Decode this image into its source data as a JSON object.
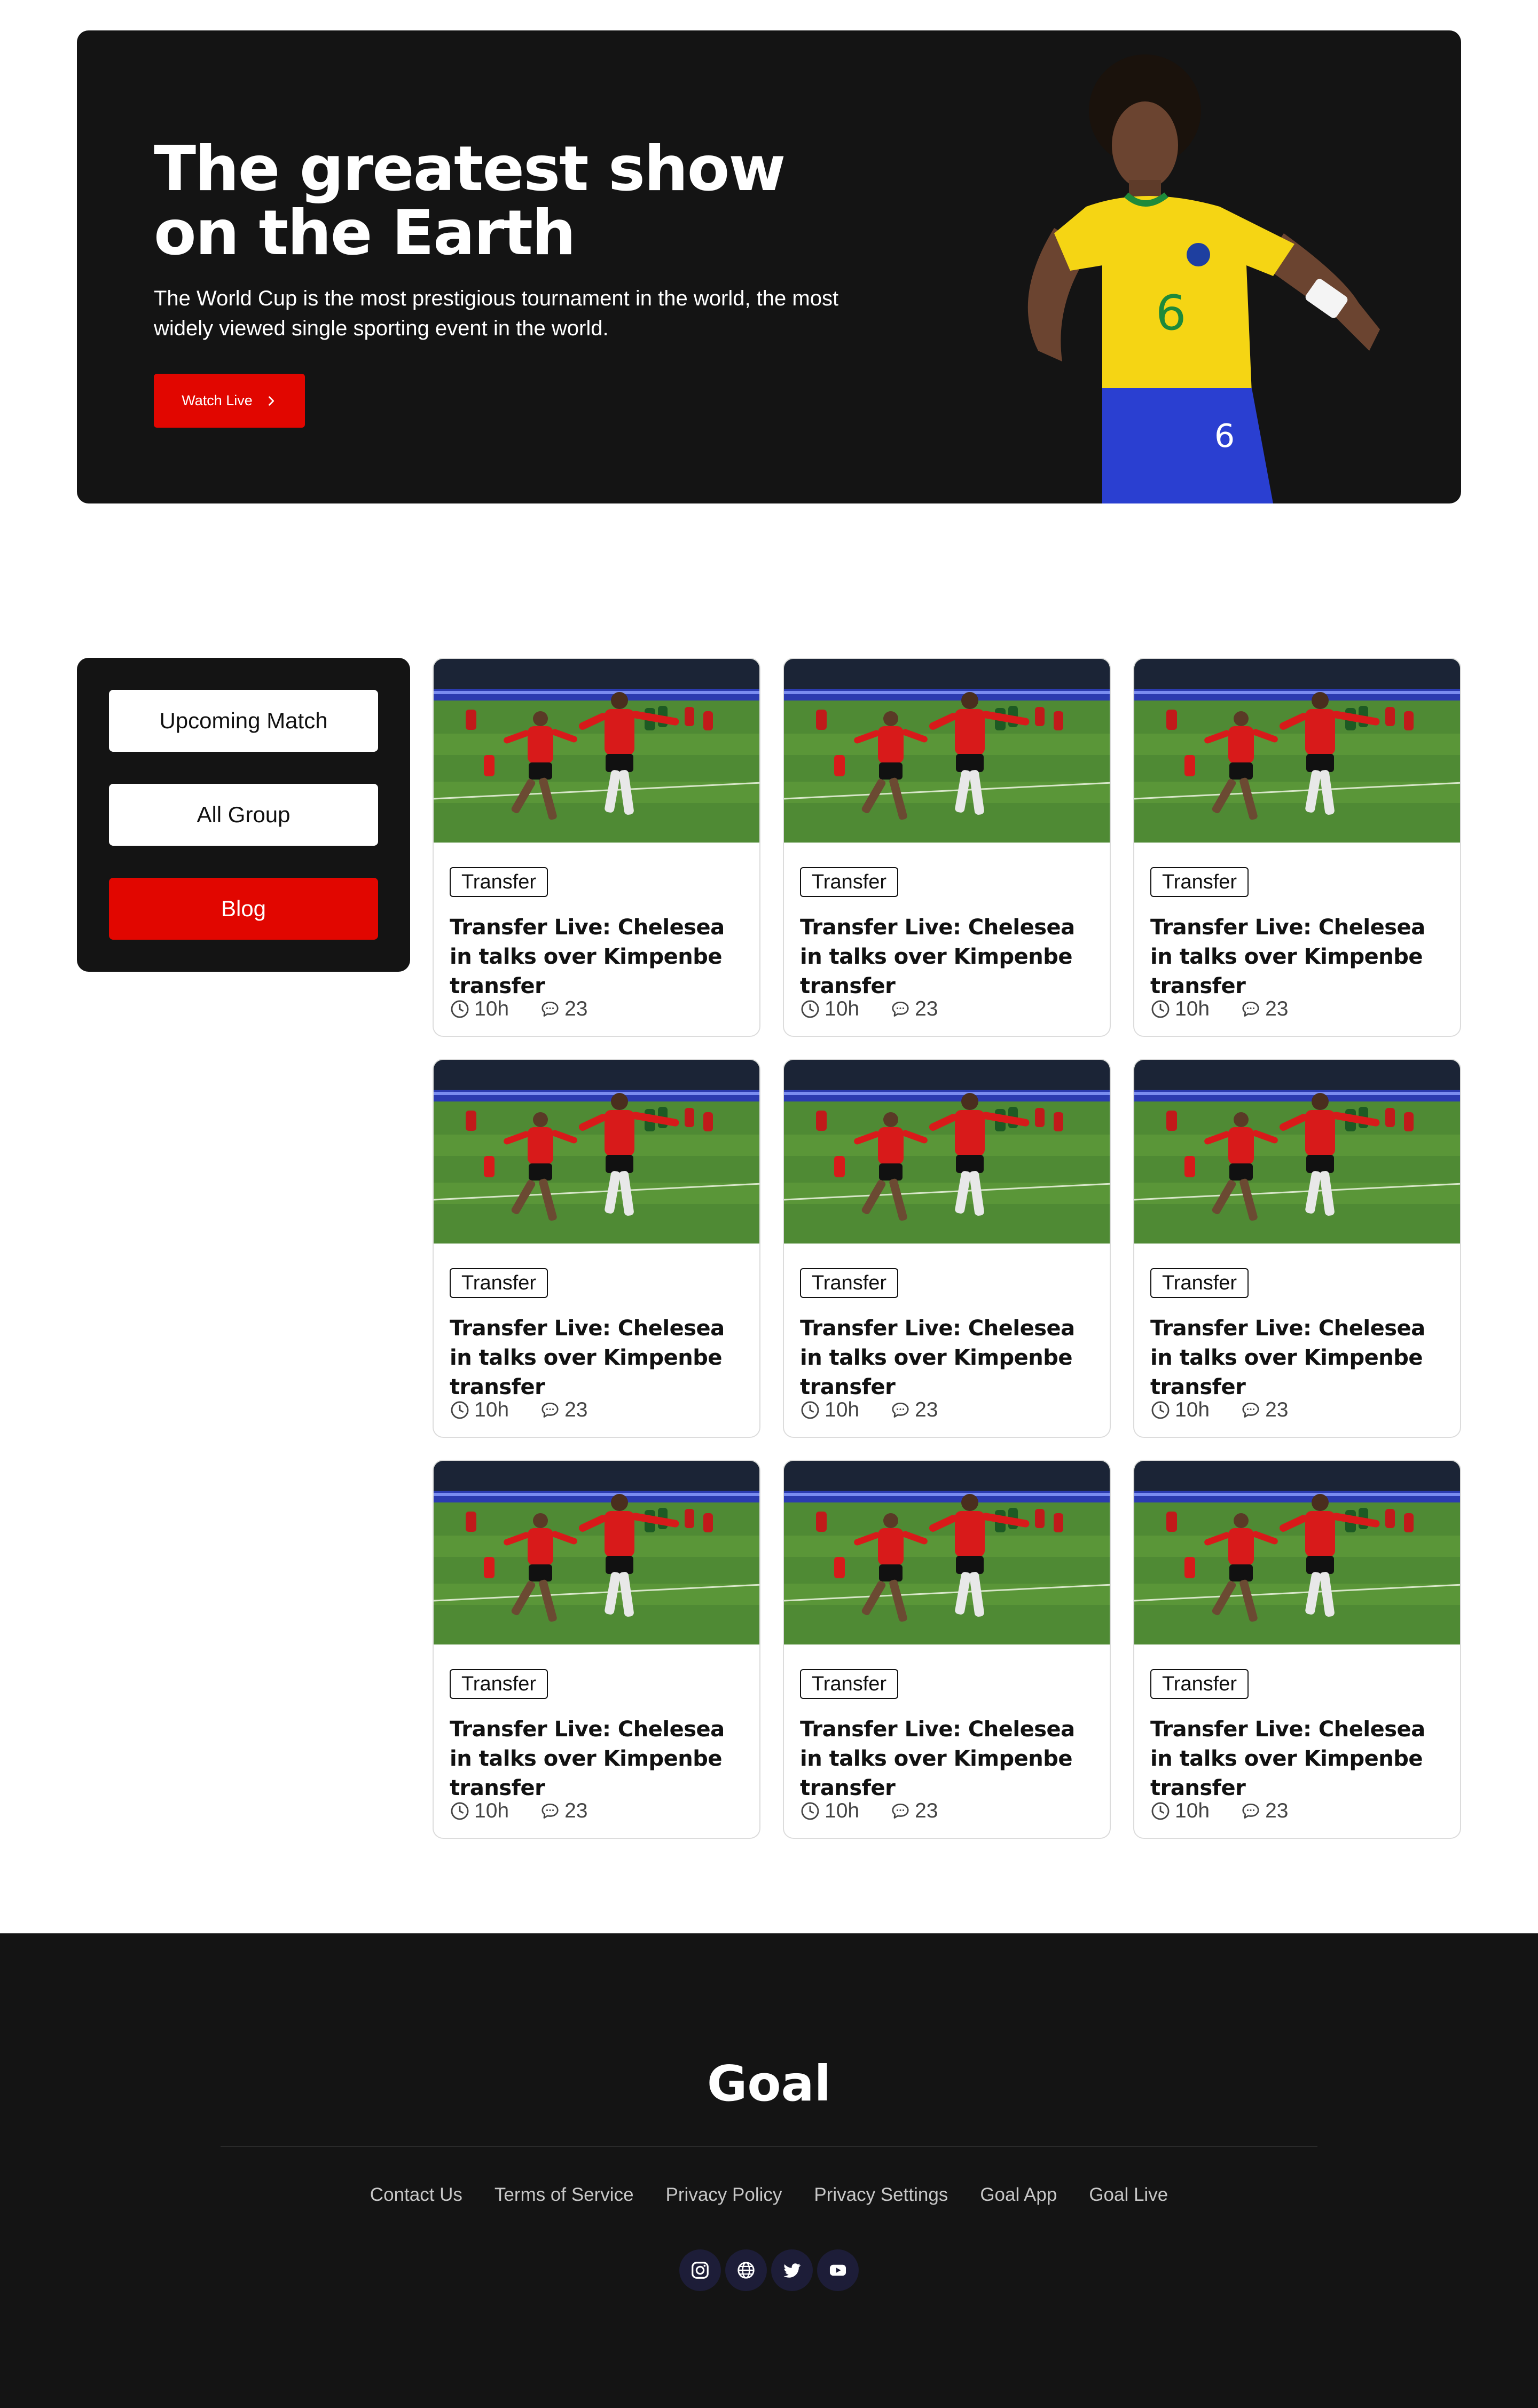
{
  "colors": {
    "accent": "#e10600",
    "dark": "#141414",
    "social_bg": "#1d1d38"
  },
  "hero": {
    "title": "The greatest show on the Earth",
    "description": "The World Cup is the most prestigious tournament in the world, the most widely viewed single sporting event in the world.",
    "button_label": "Watch Live",
    "button_icon": "chevron-right-icon"
  },
  "sidebar": {
    "items": [
      {
        "label": "Upcoming Match",
        "active": false
      },
      {
        "label": "All Group",
        "active": false
      },
      {
        "label": "Blog",
        "active": true
      }
    ]
  },
  "cards": [
    {
      "tag": "Transfer",
      "title": "Transfer Live: Chelesea in talks over Kimpenbe transfer",
      "time": "10h",
      "comments": "23"
    },
    {
      "tag": "Transfer",
      "title": "Transfer Live: Chelesea in talks over Kimpenbe transfer",
      "time": "10h",
      "comments": "23"
    },
    {
      "tag": "Transfer",
      "title": "Transfer Live: Chelesea in talks over Kimpenbe transfer",
      "time": "10h",
      "comments": "23"
    },
    {
      "tag": "Transfer",
      "title": "Transfer Live: Chelesea in talks over Kimpenbe transfer",
      "time": "10h",
      "comments": "23"
    },
    {
      "tag": "Transfer",
      "title": "Transfer Live: Chelesea in talks over Kimpenbe transfer",
      "time": "10h",
      "comments": "23"
    },
    {
      "tag": "Transfer",
      "title": "Transfer Live: Chelesea in talks over Kimpenbe transfer",
      "time": "10h",
      "comments": "23"
    },
    {
      "tag": "Transfer",
      "title": "Transfer Live: Chelesea in talks over Kimpenbe transfer",
      "time": "10h",
      "comments": "23"
    },
    {
      "tag": "Transfer",
      "title": "Transfer Live: Chelesea in talks over Kimpenbe transfer",
      "time": "10h",
      "comments": "23"
    },
    {
      "tag": "Transfer",
      "title": "Transfer Live: Chelesea in talks over Kimpenbe transfer",
      "time": "10h",
      "comments": "23"
    }
  ],
  "footer": {
    "logo": "Goal",
    "links": [
      "Contact Us",
      "Terms of Service",
      "Privacy Policy",
      "Privacy Settings",
      "Goal App",
      "Goal Live"
    ],
    "social": [
      "instagram-icon",
      "globe-icon",
      "twitter-icon",
      "youtube-icon"
    ]
  }
}
